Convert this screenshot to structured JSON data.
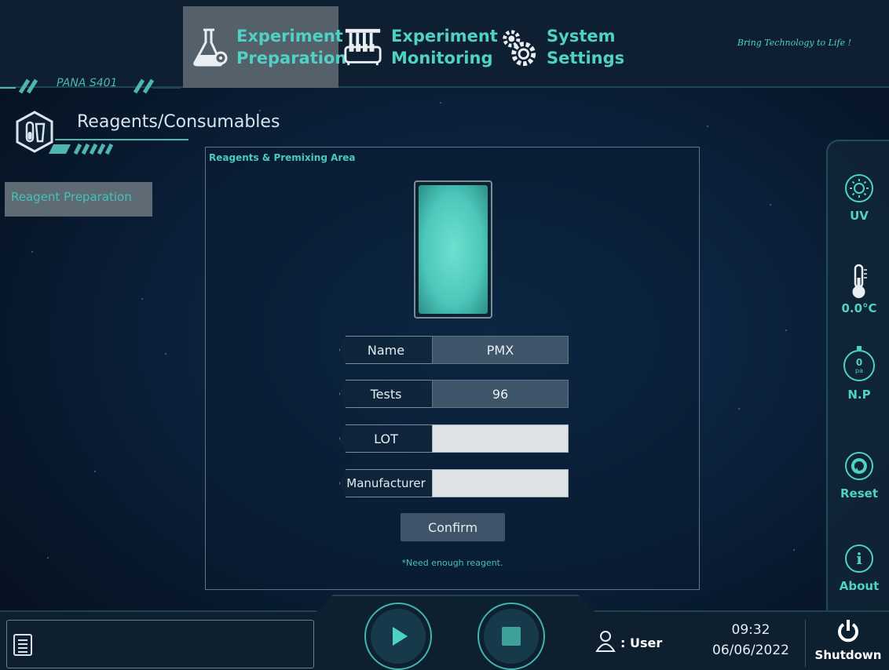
{
  "nav": {
    "tabs": [
      {
        "label": "Experiment\nPreparation",
        "icon": "flask-gear-icon",
        "active": true
      },
      {
        "label": "Experiment\nMonitoring",
        "icon": "test-tube-rack-icon",
        "active": false
      },
      {
        "label": "System\nSettings",
        "icon": "gears-icon",
        "active": false
      }
    ],
    "slogan": "Bring Technology to Life !"
  },
  "header": {
    "model": "PANA S401",
    "section_title": "Reagents/Consumables"
  },
  "sidebar": {
    "items": [
      {
        "label": "Reagent Preparation",
        "active": true
      }
    ]
  },
  "panel": {
    "title": "Reagents & Premixing Area",
    "fields": {
      "name_label": "Name",
      "name_value": "PMX",
      "tests_label": "Tests",
      "tests_value": "96",
      "lot_label": "LOT",
      "lot_value": "",
      "manufacturer_label": "Manufacturer",
      "manufacturer_value": ""
    },
    "confirm_label": "Confirm",
    "note": "*Need enough reagent."
  },
  "rail": {
    "uv_label": "UV",
    "temp_label": "0.0°C",
    "pressure_value": "0",
    "pressure_unit": "pa",
    "np_label": "N.P",
    "reset_label": "Reset",
    "about_label": "About"
  },
  "footer": {
    "user_label": ": User",
    "time": "09:32",
    "date": "06/06/2022",
    "shutdown_label": "Shutdown"
  },
  "colors": {
    "accent": "#4fd1c5",
    "active_tab": "#54606a",
    "background": "#0c2440"
  }
}
